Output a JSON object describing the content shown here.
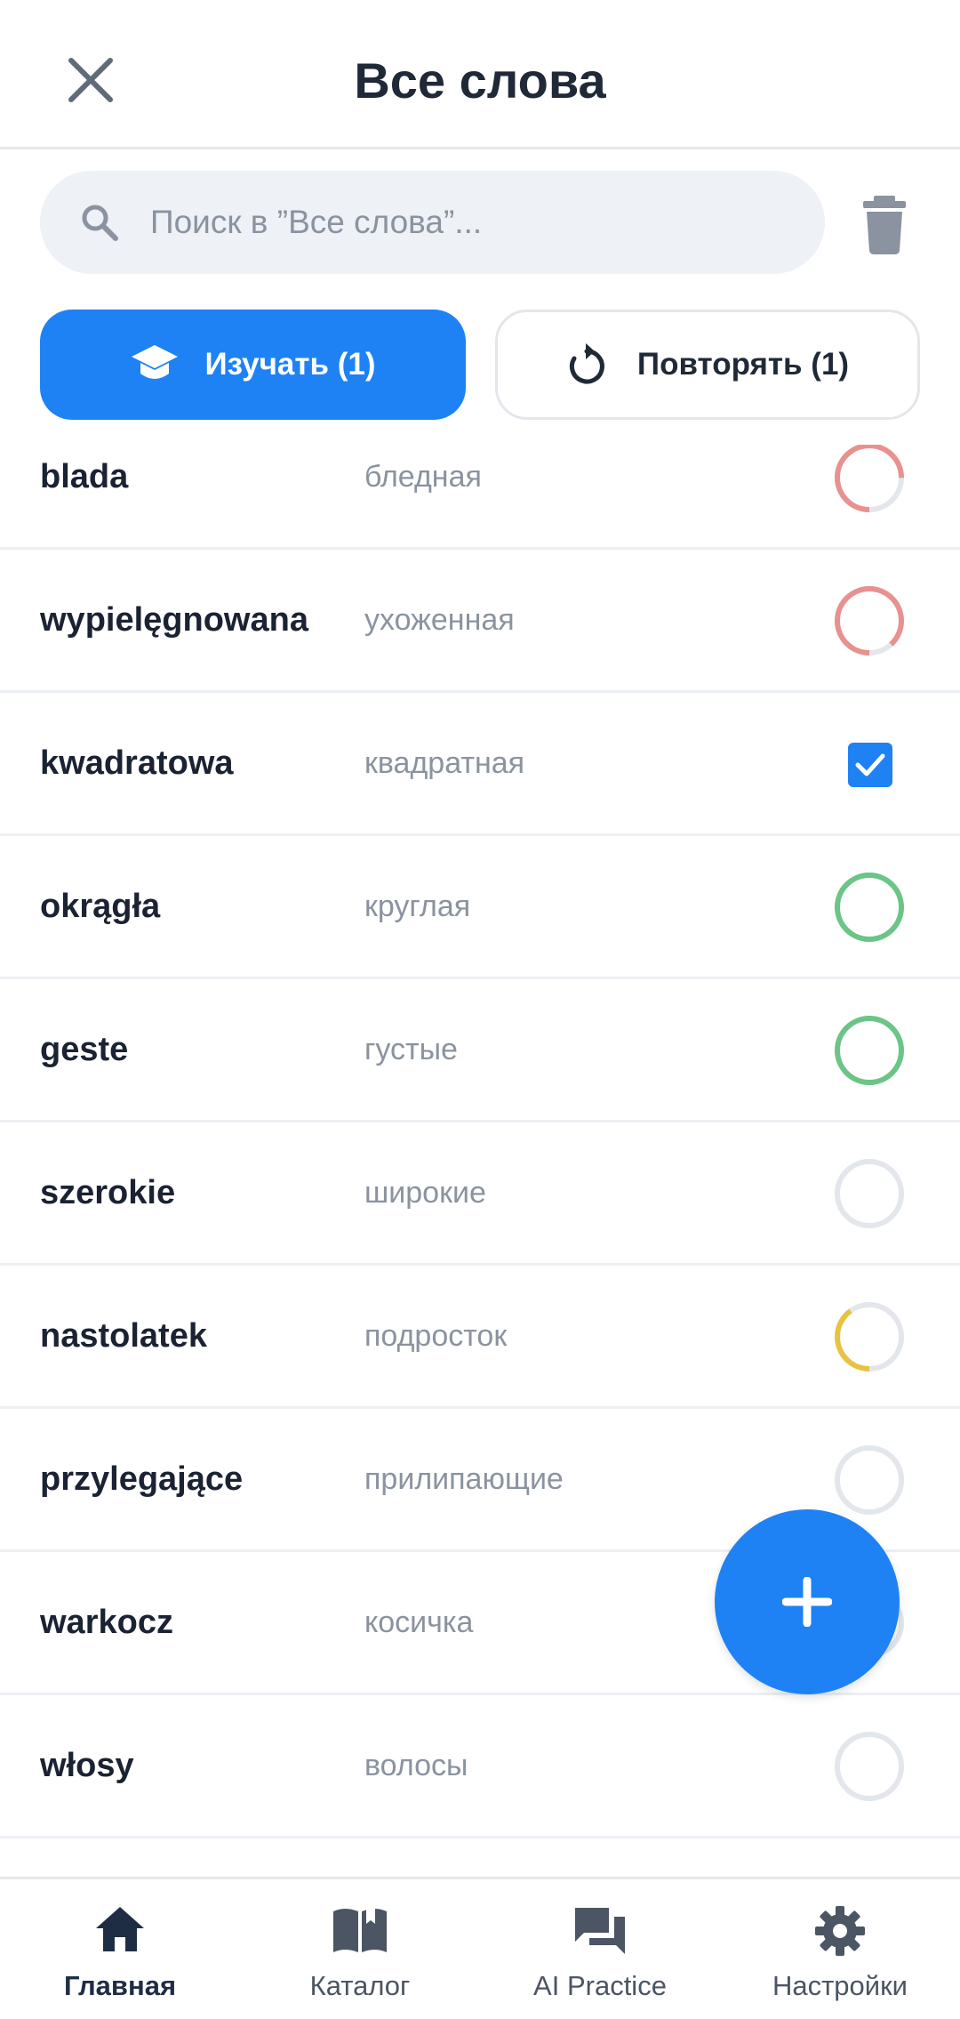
{
  "header": {
    "title": "Все слова",
    "close_icon": "close-icon"
  },
  "search": {
    "placeholder": "Поиск в ”Все слова”...",
    "value": "",
    "icon": "search-icon",
    "trash_icon": "trash-icon"
  },
  "actions": {
    "learn_label": "Изучать (1)",
    "learn_icon": "graduation-cap-icon",
    "review_label": "Повторять (1)",
    "review_icon": "refresh-icon"
  },
  "colors": {
    "accent": "#1e82f5",
    "progress_red": "#e8918f",
    "progress_green": "#6cc487",
    "progress_yellow": "#e8c341",
    "progress_track": "#e3e7ec"
  },
  "words": [
    {
      "word": "blada",
      "translation": "бледная",
      "status": "partial",
      "color": "#e8918f",
      "progress": 0.75
    },
    {
      "word": "wypielęgnowana",
      "translation": "ухоженная",
      "status": "partial",
      "color": "#e8918f",
      "progress": 0.88
    },
    {
      "word": "kwadratowa",
      "translation": "квадратная",
      "status": "checked"
    },
    {
      "word": "okrągła",
      "translation": "круглая",
      "status": "full",
      "color": "#6cc487",
      "progress": 1
    },
    {
      "word": "geste",
      "translation": "густые",
      "status": "full",
      "color": "#6cc487",
      "progress": 1
    },
    {
      "word": "szerokie",
      "translation": "широкие",
      "status": "empty",
      "progress": 0
    },
    {
      "word": "nastolatek",
      "translation": "подросток",
      "status": "partial",
      "color": "#e8c341",
      "progress": 0.4
    },
    {
      "word": "przylegające",
      "translation": "прилипающие",
      "status": "empty",
      "progress": 0
    },
    {
      "word": "warkocz",
      "translation": "косичка",
      "status": "empty",
      "progress": 0
    },
    {
      "word": "włosy",
      "translation": "волосы",
      "status": "empty",
      "progress": 0
    }
  ],
  "fab": {
    "icon": "plus-icon"
  },
  "nav": [
    {
      "label": "Главная",
      "icon": "home-icon",
      "active": true
    },
    {
      "label": "Каталог",
      "icon": "book-icon",
      "active": false
    },
    {
      "label": "AI Practice",
      "icon": "chat-icon",
      "active": false
    },
    {
      "label": "Настройки",
      "icon": "gear-icon",
      "active": false
    }
  ]
}
